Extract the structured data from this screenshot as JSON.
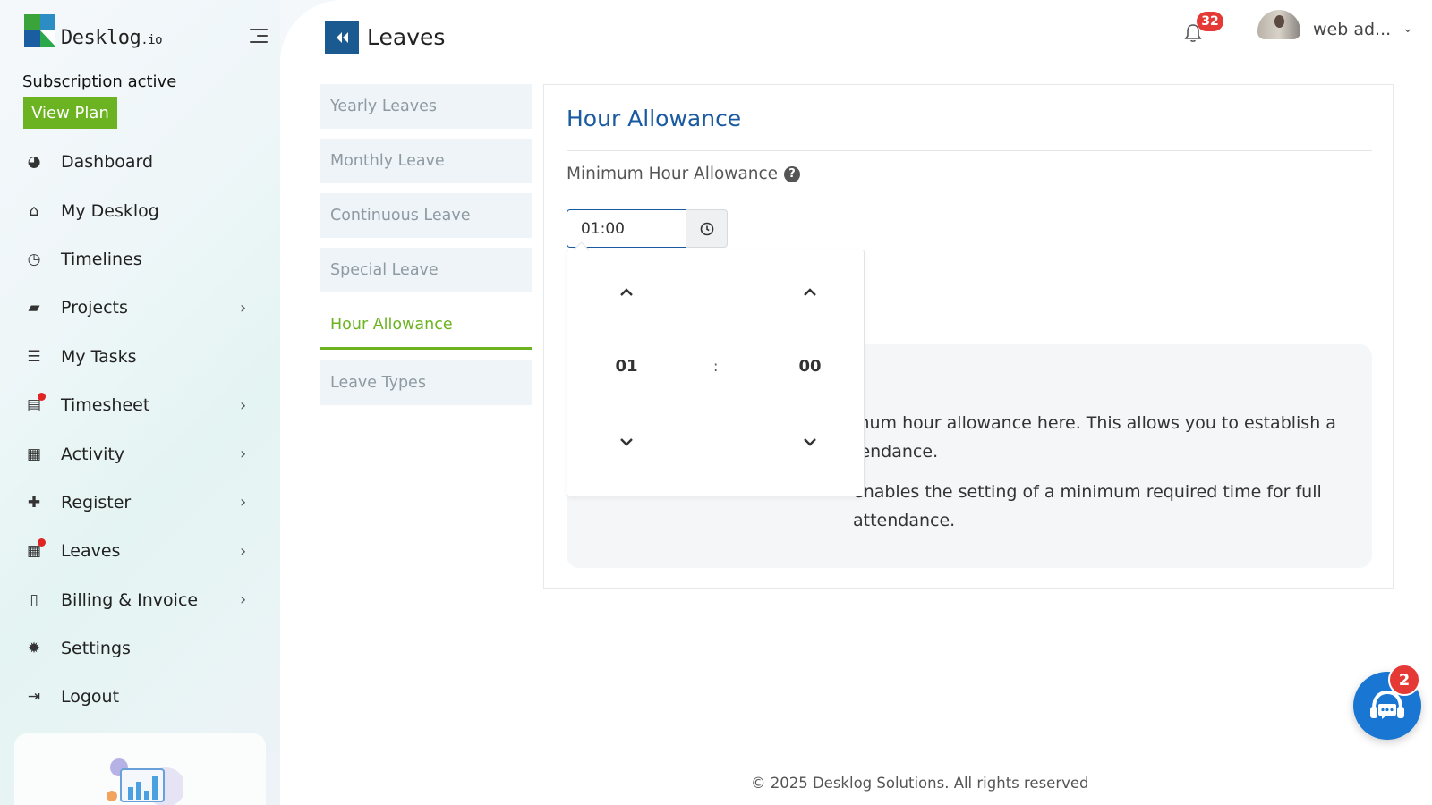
{
  "brand": {
    "name": "Desklog",
    "suffix": ".io"
  },
  "subscription": {
    "status_text": "Subscription active",
    "view_plan_label": "View Plan"
  },
  "sidebar": {
    "items": [
      {
        "label": "Dashboard",
        "icon": "dashboard-icon",
        "glyph": "◕",
        "has_chevron": false,
        "dot": false
      },
      {
        "label": "My Desklog",
        "icon": "home-icon",
        "glyph": "⌂",
        "has_chevron": false,
        "dot": false
      },
      {
        "label": "Timelines",
        "icon": "clock-icon",
        "glyph": "◷",
        "has_chevron": false,
        "dot": false
      },
      {
        "label": "Projects",
        "icon": "book-icon",
        "glyph": "▰",
        "has_chevron": true,
        "dot": false
      },
      {
        "label": "My Tasks",
        "icon": "tasks-icon",
        "glyph": "☰",
        "has_chevron": false,
        "dot": false
      },
      {
        "label": "Timesheet",
        "icon": "timesheet-icon",
        "glyph": "▤",
        "has_chevron": true,
        "dot": true
      },
      {
        "label": "Activity",
        "icon": "grid-icon",
        "glyph": "▦",
        "has_chevron": true,
        "dot": false
      },
      {
        "label": "Register",
        "icon": "plus-icon",
        "glyph": "✚",
        "has_chevron": true,
        "dot": false
      },
      {
        "label": "Leaves",
        "icon": "calendar-icon",
        "glyph": "▦",
        "has_chevron": true,
        "dot": true
      },
      {
        "label": "Billing & Invoice",
        "icon": "invoice-icon",
        "glyph": "▯",
        "has_chevron": true,
        "dot": false
      },
      {
        "label": "Settings",
        "icon": "gear-icon",
        "glyph": "✹",
        "has_chevron": false,
        "dot": false
      },
      {
        "label": "Logout",
        "icon": "logout-icon",
        "glyph": "⇥",
        "has_chevron": false,
        "dot": false
      }
    ],
    "chevron": "›"
  },
  "header": {
    "page_title": "Leaves",
    "notification_count": "32",
    "user_name": "web ad...",
    "user_chevron": "⌄"
  },
  "leave_menu": {
    "items": [
      {
        "label": "Yearly Leaves",
        "active": false
      },
      {
        "label": "Monthly Leave",
        "active": false
      },
      {
        "label": "Continuous Leave",
        "active": false
      },
      {
        "label": "Special Leave",
        "active": false
      },
      {
        "label": "Hour Allowance",
        "active": true
      },
      {
        "label": "Leave Types",
        "active": false
      }
    ]
  },
  "panel": {
    "title": "Hour Allowance",
    "field_label": "Minimum Hour Allowance",
    "help_glyph": "?",
    "time_value": "01:00",
    "info_lines": [
      "mum hour allowance here. This allows you to establish a tendance.",
      "enables the setting of a minimum required time for full attendance."
    ]
  },
  "time_picker": {
    "hours": "01",
    "separator": ":",
    "minutes": "00"
  },
  "footer": {
    "text": "© 2025 Desklog Solutions. All rights reserved"
  },
  "chat": {
    "badge_count": "2"
  },
  "colors": {
    "accent_green": "#6bb320",
    "primary_blue": "#1a5aa0",
    "badge_red": "#e53935"
  }
}
